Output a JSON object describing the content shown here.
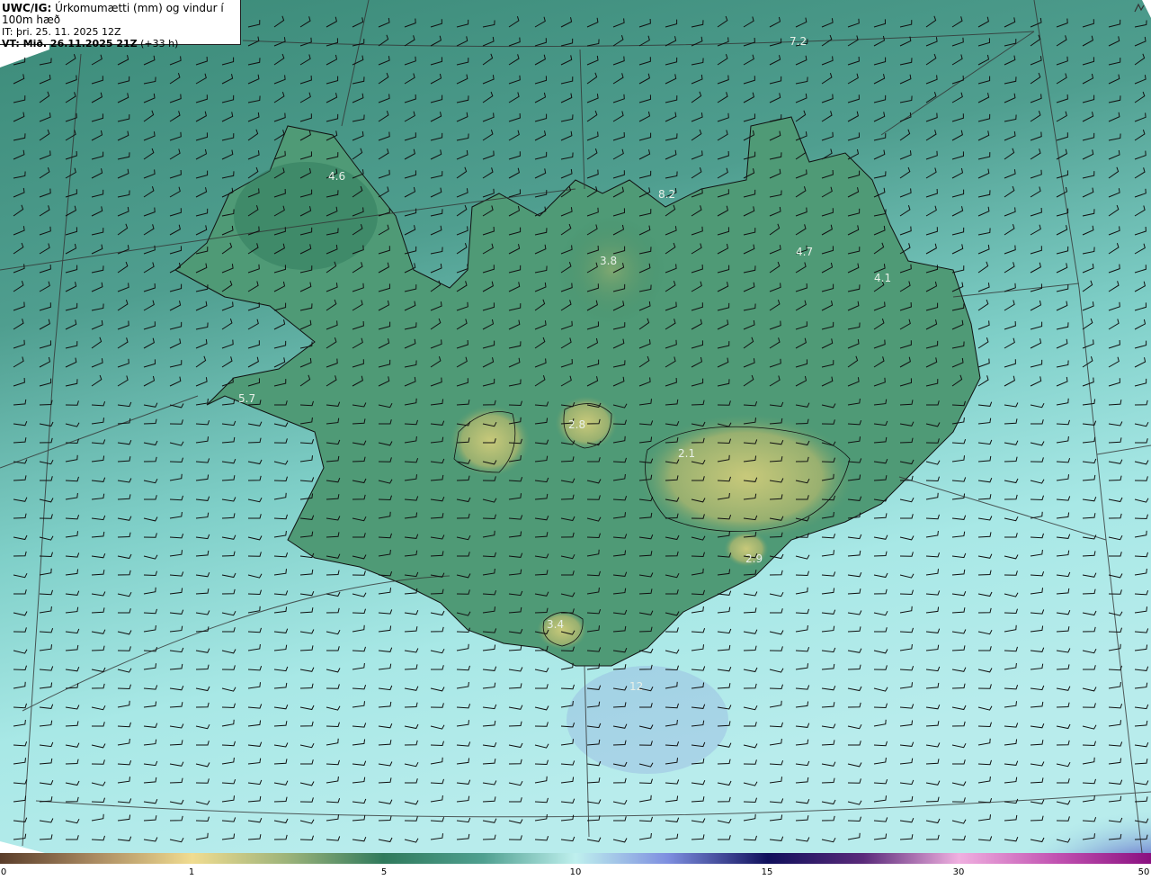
{
  "header": {
    "line1_prefix": "UWC/IG:",
    "line1_text": " Úrkomumætti (mm) og vindur í 100m hæð",
    "line2": "IT: þri. 25. 11. 2025 12Z",
    "line3_prefix": "VT: Mið. 26.11.2025 21Z",
    "line3_text": " (+33 h)"
  },
  "map_labels": [
    {
      "text": "7.2"
    },
    {
      "text": "4.6"
    },
    {
      "text": "8.2"
    },
    {
      "text": "3.8"
    },
    {
      "text": "4.7"
    },
    {
      "text": "4.1"
    },
    {
      "text": "2.8"
    },
    {
      "text": "2.1"
    },
    {
      "text": "2.9"
    },
    {
      "text": "3.4"
    },
    {
      "text": "5.7"
    },
    {
      "text": "12"
    }
  ],
  "colorbar": {
    "ticks": [
      "0",
      "1",
      "5",
      "10",
      "15",
      "30",
      "50"
    ]
  },
  "colors": {
    "ocean_deep": "#3f8f80",
    "ocean_light": "#9fe3e3",
    "land_low": "#4a8f6c",
    "land_high": "#b8c37a",
    "coast": "#111111",
    "grid": "#333333",
    "barb": "#111111"
  },
  "icons": {
    "corner": "toggle-icon"
  }
}
